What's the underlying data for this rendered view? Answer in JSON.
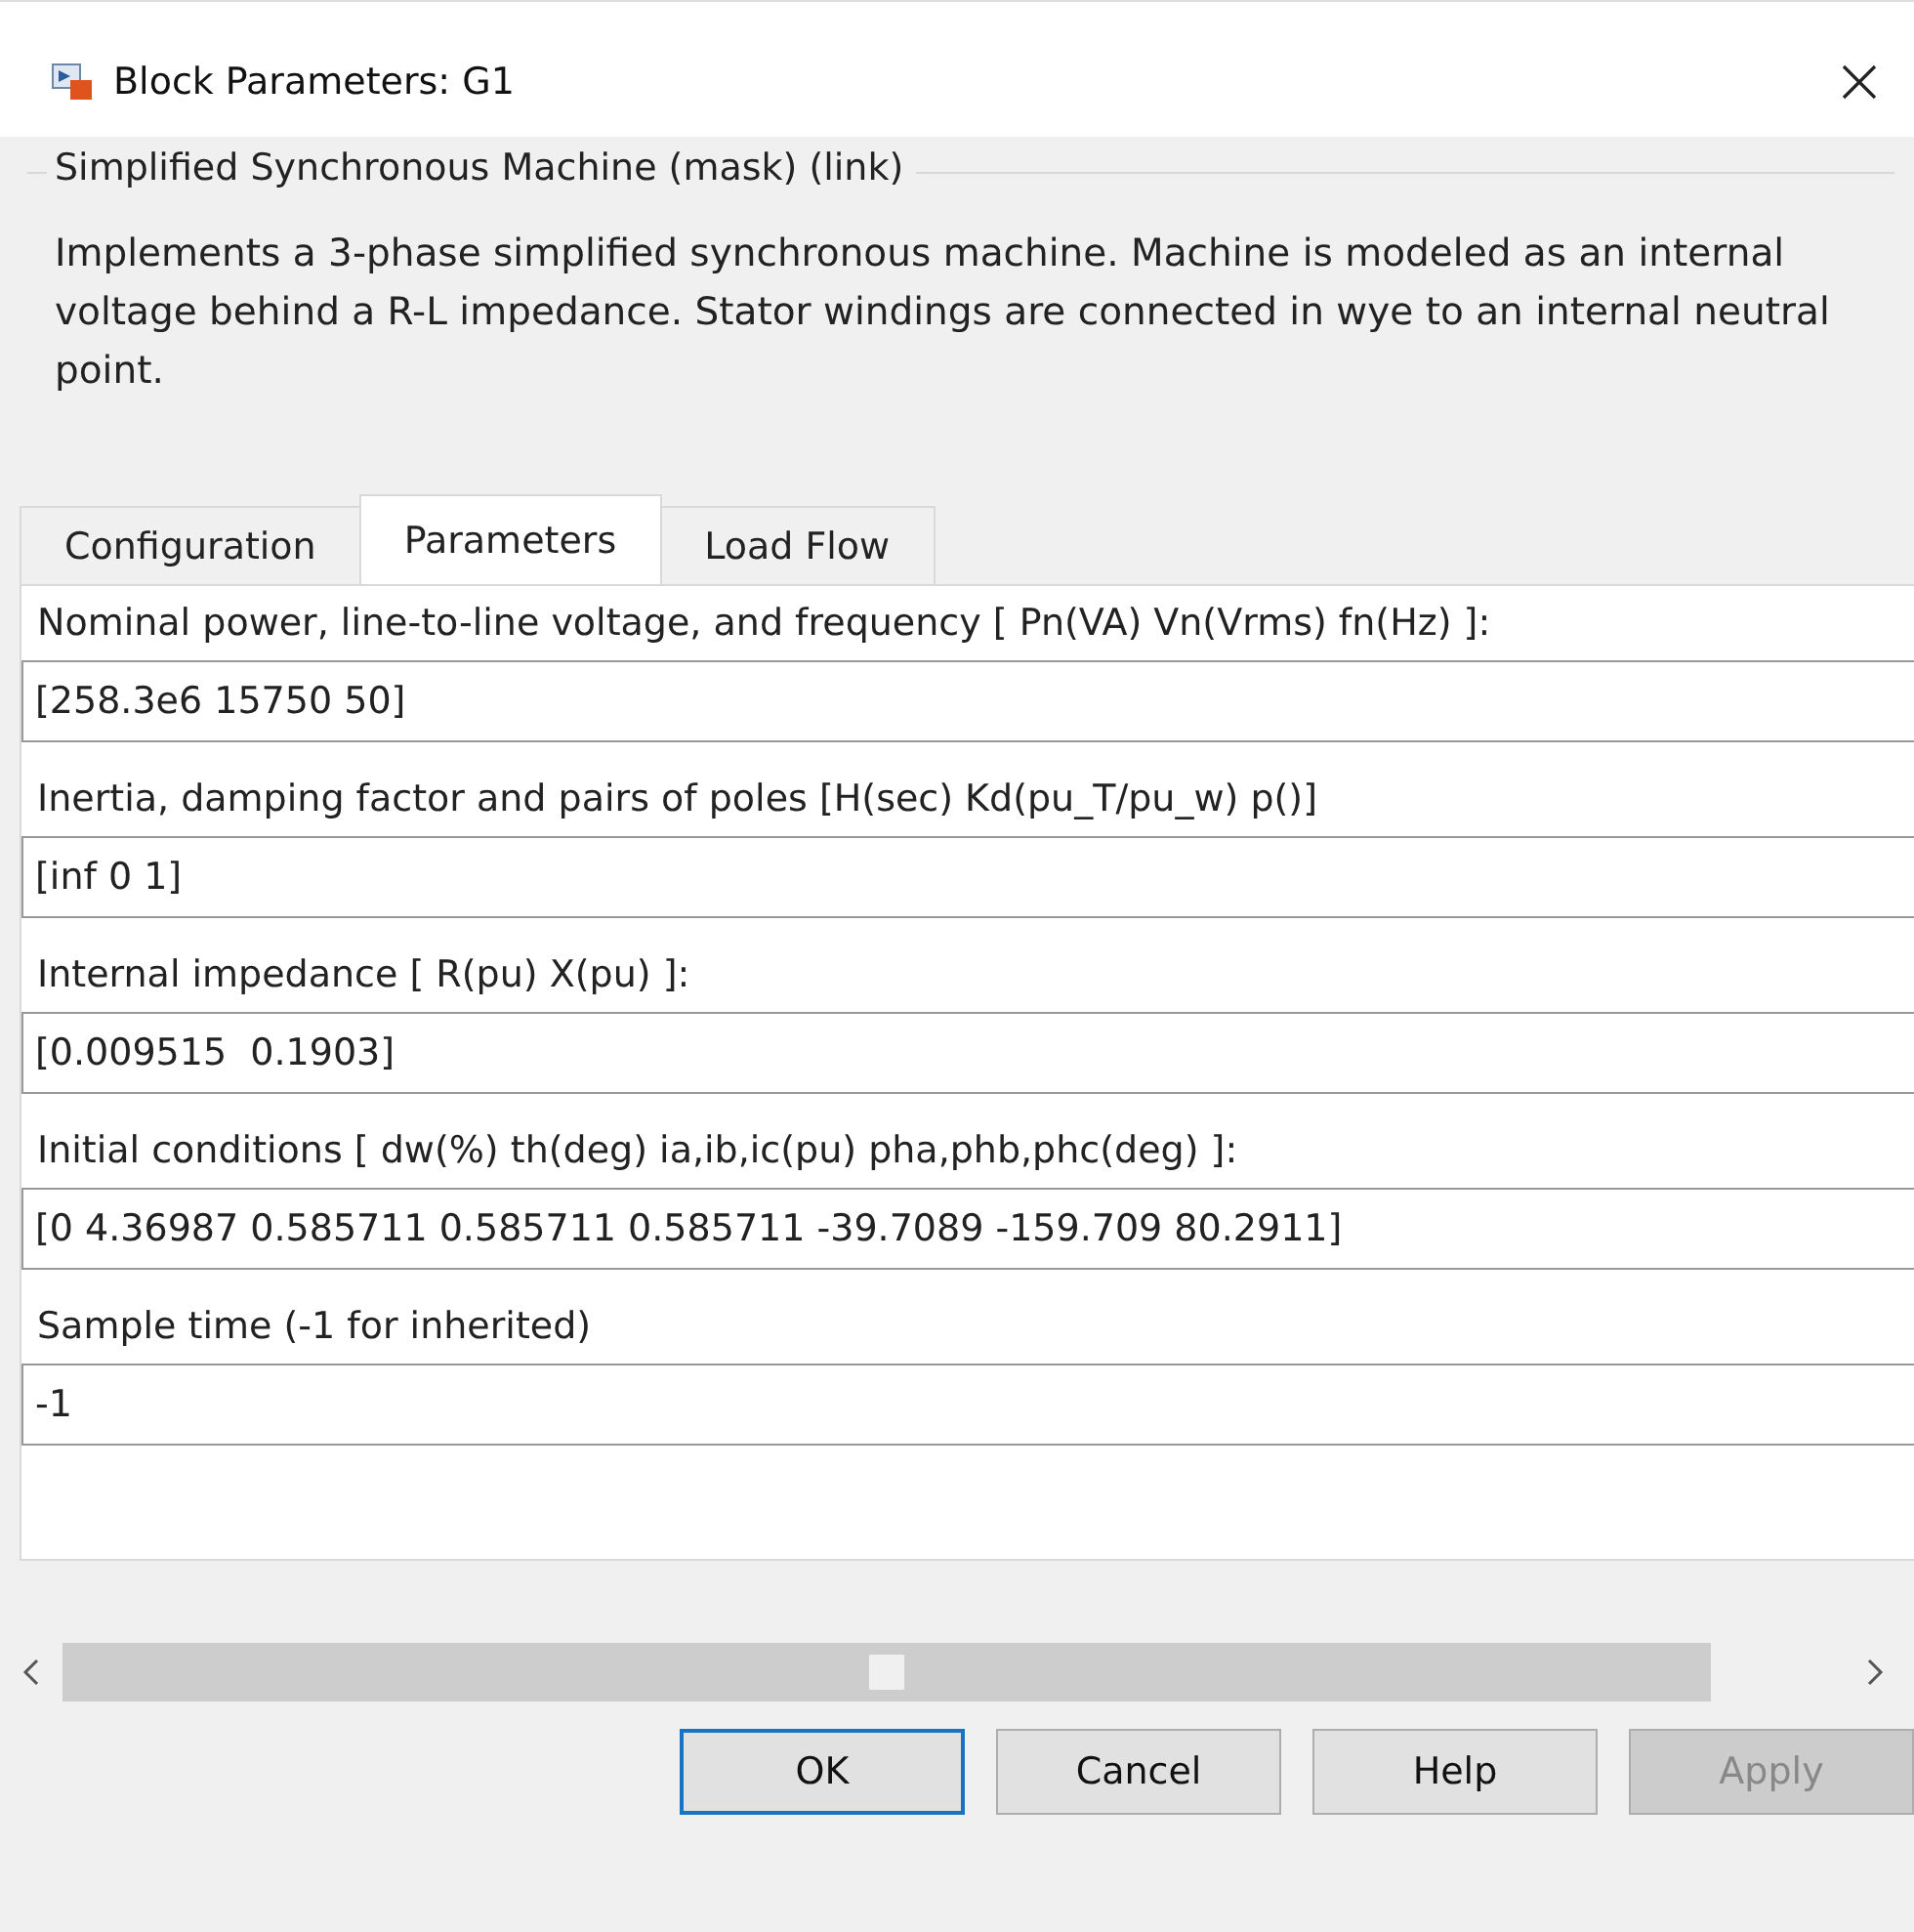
{
  "window": {
    "title": "Block Parameters: G1"
  },
  "group": {
    "title": "Simplified Synchronous Machine (mask) (link)",
    "description": "Implements a 3-phase simplified synchronous machine. Machine is modeled as an internal voltage behind a R-L impedance. Stator windings are connected in wye to an internal neutral point."
  },
  "tabs": [
    {
      "label": "Configuration",
      "selected": false
    },
    {
      "label": "Parameters",
      "selected": true
    },
    {
      "label": "Load Flow",
      "selected": false
    }
  ],
  "parameters": [
    {
      "label": "Nominal power, line-to-line voltage, and frequency [ Pn(VA) Vn(Vrms) fn(Hz) ]:",
      "value": "[258.3e6 15750 50]"
    },
    {
      "label": "Inertia, damping factor and pairs of poles [H(sec) Kd(pu_T/pu_w) p()]",
      "value": "[inf 0 1]"
    },
    {
      "label": "Internal impedance [ R(pu)  X(pu) ]:",
      "value": "[0.009515  0.1903]"
    },
    {
      "label": "Initial conditions [ dw(%)  th(deg)  ia,ib,ic(pu)  pha,phb,phc(deg) ]:",
      "value": "[0 4.36987 0.585711 0.585711 0.585711 -39.7089 -159.709 80.2911]"
    },
    {
      "label": "Sample time (-1 for inherited)",
      "value": "-1"
    }
  ],
  "buttons": [
    {
      "label": "OK",
      "default": true,
      "disabled": false
    },
    {
      "label": "Cancel",
      "default": false,
      "disabled": false
    },
    {
      "label": "Help",
      "default": false,
      "disabled": false
    },
    {
      "label": "Apply",
      "default": false,
      "disabled": true
    }
  ]
}
